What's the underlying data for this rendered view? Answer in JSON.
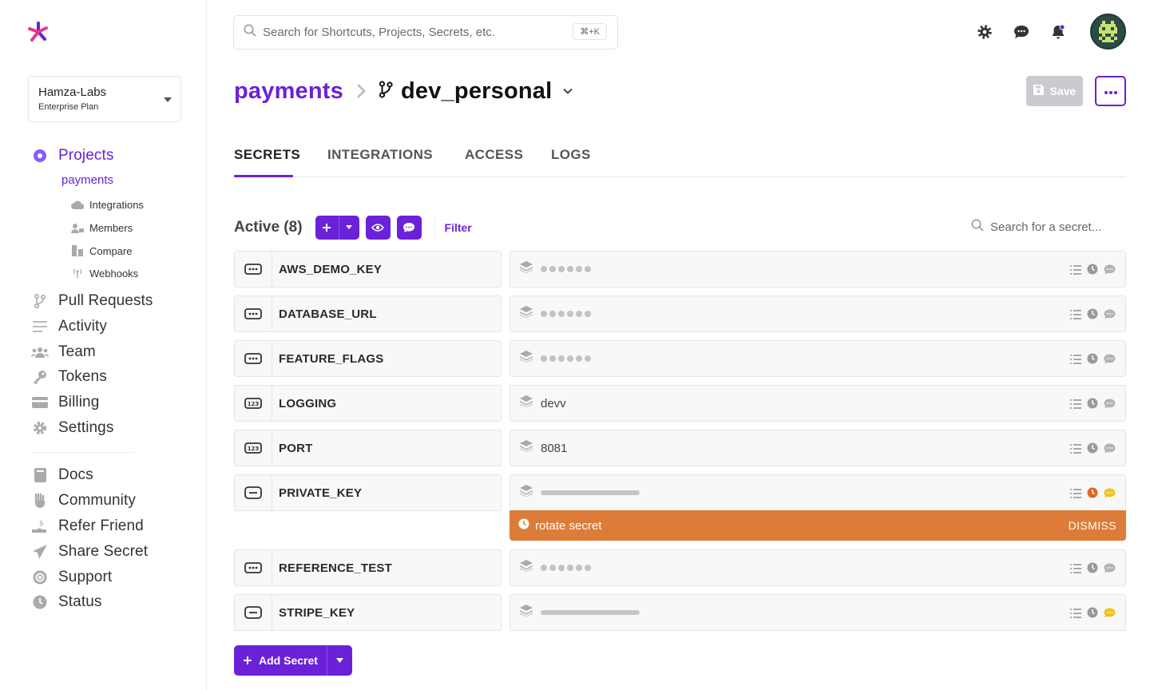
{
  "sidebar": {
    "org": {
      "name": "Hamza-Labs",
      "plan": "Enterprise Plan"
    },
    "nav": {
      "projects": "Projects",
      "project_current": "payments",
      "sub": {
        "integrations": "Integrations",
        "members": "Members",
        "compare": "Compare",
        "webhooks": "Webhooks"
      },
      "pull_requests": "Pull Requests",
      "activity": "Activity",
      "team": "Team",
      "tokens": "Tokens",
      "billing": "Billing",
      "settings": "Settings",
      "docs": "Docs",
      "community": "Community",
      "refer": "Refer Friend",
      "share": "Share Secret",
      "support": "Support",
      "status": "Status"
    }
  },
  "header": {
    "search_placeholder": "Search for Shortcuts, Projects, Secrets, etc.",
    "search_shortcut": "⌘+K"
  },
  "title": {
    "project": "payments",
    "environment": "dev_personal"
  },
  "actions": {
    "save": "Save"
  },
  "tabs": {
    "secrets": "SECRETS",
    "integrations": "INTEGRATIONS",
    "access": "ACCESS",
    "logs": "LOGS"
  },
  "secrets_toolbar": {
    "title": "Active (8)",
    "filter": "Filter",
    "search_placeholder": "Search for a secret..."
  },
  "secrets": [
    {
      "name": "AWS_DEMO_KEY",
      "type": "string",
      "value": ""
    },
    {
      "name": "DATABASE_URL",
      "type": "string",
      "value": ""
    },
    {
      "name": "FEATURE_FLAGS",
      "type": "string",
      "value": ""
    },
    {
      "name": "LOGGING",
      "type": "number",
      "value": "devv"
    },
    {
      "name": "PORT",
      "type": "number",
      "value": "8081"
    },
    {
      "name": "PRIVATE_KEY",
      "type": "multiline",
      "value": ""
    },
    {
      "name": "REFERENCE_TEST",
      "type": "string",
      "value": ""
    },
    {
      "name": "STRIPE_KEY",
      "type": "multiline",
      "value": ""
    }
  ],
  "rotate_banner": {
    "text": "rotate secret",
    "dismiss": "DISMISS"
  },
  "add_secret": {
    "label": "Add Secret"
  },
  "colors": {
    "accent": "#6b21d8",
    "warning": "#dd7c38",
    "comment_yellow": "#f5c518"
  }
}
